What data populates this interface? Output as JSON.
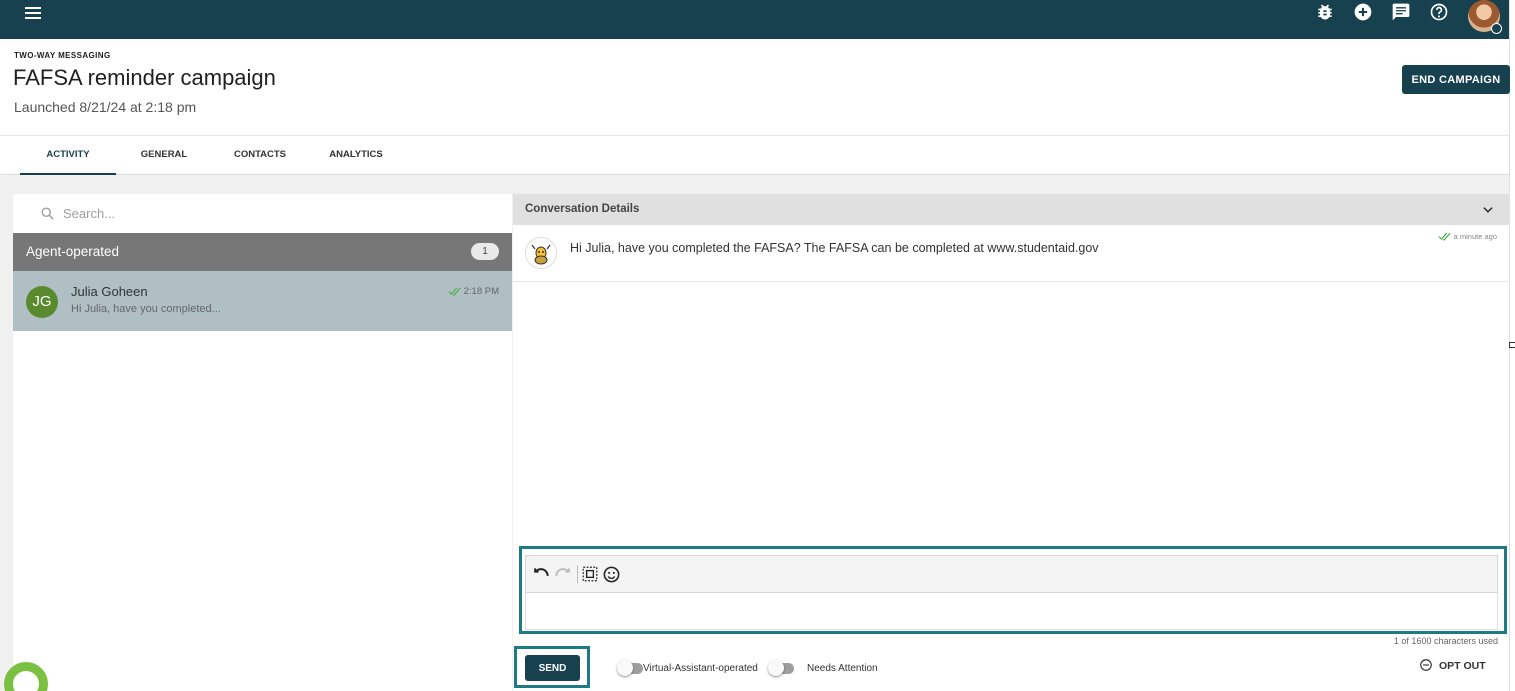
{
  "topbar": {
    "icons": [
      "menu-icon",
      "bug-icon",
      "add-circle-icon",
      "chat-icon",
      "help-icon",
      "user-avatar"
    ]
  },
  "header": {
    "eyebrow": "TWO-WAY MESSAGING",
    "title": "FAFSA reminder campaign",
    "subtitle": "Launched 8/21/24 at 2:18 pm",
    "end_button": "END CAMPAIGN"
  },
  "tabs": [
    {
      "label": "ACTIVITY",
      "active": true
    },
    {
      "label": "GENERAL",
      "active": false
    },
    {
      "label": "CONTACTS",
      "active": false
    },
    {
      "label": "ANALYTICS",
      "active": false
    }
  ],
  "conversations": {
    "search_placeholder": "Search...",
    "group": {
      "label": "Agent-operated",
      "count": "1"
    },
    "items": [
      {
        "initials": "JG",
        "name": "Julia Goheen",
        "preview": "Hi Julia, have you completed...",
        "time": "2:18 PM"
      }
    ]
  },
  "details": {
    "title": "Conversation Details",
    "messages": [
      {
        "text": "Hi Julia, have you completed the FAFSA? The FAFSA can be completed at www.studentaid.gov",
        "time": "a minute ago"
      }
    ],
    "char_count": "1 of 1600 characters used",
    "send_label": "SEND",
    "toggle_va": "Virtual-Assistant-operated",
    "toggle_attention": "Needs Attention",
    "opt_out": "OPT OUT"
  },
  "colors": {
    "primary": "#17414f",
    "highlight": "#1e7b86",
    "avatar_green": "#5a8a2e",
    "selected_row": "#b0bfc4",
    "read_check": "#4caf50"
  }
}
